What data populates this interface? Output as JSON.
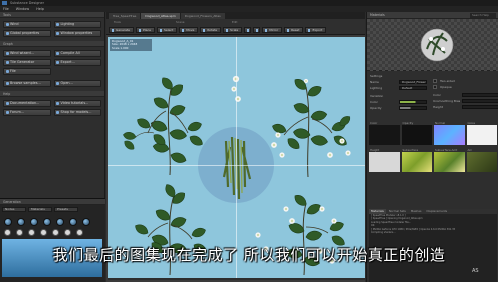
{
  "window": {
    "title": "Substance Designer"
  },
  "menu": [
    "File",
    "Window",
    "Help"
  ],
  "left_panel": {
    "header_1": "Tools",
    "buttons_row1": [
      "Wind",
      "Lighting"
    ],
    "buttons_row2": [
      "Global properties",
      "Window properties"
    ],
    "header_2": "Graph",
    "buttons_row3": [
      "Wind wizard...",
      "Compile All"
    ],
    "buttons_row4": [
      "Tile Generator",
      "Export..."
    ],
    "buttons_row5": [
      "File"
    ],
    "buttons_row6": [
      "Browse samples...",
      "Open..."
    ],
    "header_3": "Help",
    "buttons_row7": [
      "Documentation...",
      "Video tutorials..."
    ],
    "buttons_row8": [
      "Forum...",
      "Shop for models..."
    ],
    "node_header": "Generation",
    "node_tabs": [
      "Nodes",
      "Materials",
      "Presets"
    ]
  },
  "center": {
    "doc_tabs": [
      "Tree_SpeedTree",
      "Dogwood_Atlas.spm",
      "Dogwood_Flowers_Atlas"
    ],
    "tool_row": [
      "Tools",
      "Scene",
      "Edit"
    ],
    "toolbar": [
      "Generate",
      "Place",
      "Select",
      "Move",
      "Rotate",
      "Scale",
      "Add",
      "Remove",
      "Mirror",
      "Collision",
      "Reset",
      "Export"
    ],
    "info": [
      "Dogwood_A_01",
      "Size: 2048 x 2048",
      "Scale 1.000"
    ]
  },
  "right_panel": {
    "header": "Materials",
    "search": "Search Help",
    "props": [
      {
        "label": "Settings",
        "value": ""
      },
      {
        "label": "Name",
        "value": "Dogwood_Flower"
      },
      {
        "label": "Lighting",
        "value": "Default"
      },
      {
        "label": "Variation",
        "value": ""
      },
      {
        "label": "Color",
        "value": ""
      },
      {
        "label": "Opacity",
        "value": ""
      }
    ],
    "side_props": [
      {
        "label": "Two-sided",
        "value": ""
      },
      {
        "label": "Opaque",
        "value": ""
      },
      {
        "label": "Color",
        "value": ""
      },
      {
        "label": "Unsmoothing Bias",
        "value": ""
      },
      {
        "label": "Height",
        "value": ""
      }
    ],
    "maps_header": [
      "Color",
      "Opacity",
      "Normal",
      "Gloss"
    ],
    "maps": [
      "Color",
      "Opacity",
      "Normal",
      "Gloss",
      "Height",
      "Subsurface",
      "Subsurface Amt",
      "AO"
    ],
    "console_tabs": [
      "Materials",
      "Normal Sets",
      "Meshes",
      "Displacements"
    ],
    "console_lines": [
      "[ SpeedTree Modeler v8.1.0 ]",
      "[ SpeedTree ] Opening Dogwood_Atlas.spm",
      "Loading SpeedTree modeler file...",
      "OK",
      "[ NVIDIA Geforce GTX 1080 / PCIe/SSE2 ] OpenGL 4.6.0 NVIDIA 391.35",
      "Compiling shaders..."
    ]
  },
  "subtitle": "我们最后的图集现在完成了 所以我们可以开始真正的创造",
  "watermark": "AS"
}
